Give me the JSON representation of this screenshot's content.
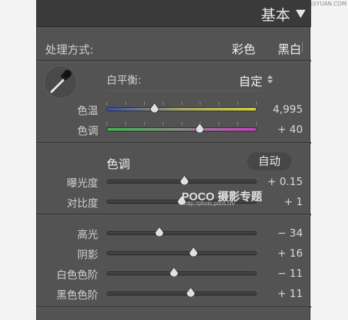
{
  "header": {
    "title": "基本"
  },
  "treatment": {
    "label": "处理方式:",
    "color_option": "彩色",
    "bw_option": "黑白"
  },
  "white_balance": {
    "label": "白平衡:",
    "value": "自定"
  },
  "sliders_wb": [
    {
      "label": "色温",
      "value": "4,995",
      "position": 0.32,
      "track": "temp"
    },
    {
      "label": "色调",
      "value": "+ 40",
      "position": 0.62,
      "track": "tint"
    }
  ],
  "tone": {
    "heading": "色调",
    "auto_label": "自动"
  },
  "sliders_tone": [
    {
      "label": "曝光度",
      "value": "+ 0.15",
      "position": 0.52
    },
    {
      "label": "对比度",
      "value": "+ 1",
      "position": 0.5
    }
  ],
  "sliders_light": [
    {
      "label": "高光",
      "value": "− 34",
      "position": 0.35
    },
    {
      "label": "阴影",
      "value": "+ 16",
      "position": 0.58
    },
    {
      "label": "白色色阶",
      "value": "− 11",
      "position": 0.45
    },
    {
      "label": "黑色色阶",
      "value": "+ 11",
      "position": 0.56
    }
  ],
  "watermark": {
    "top": "思缘设计论坛 WWW.MISSYUAN.COM",
    "brand": "POCO 摄影专题",
    "url": "http://photo.poco.cn/"
  },
  "colors": {
    "panel": "#535353",
    "header": "#3a3a3a",
    "text": "#d0d0d0"
  }
}
